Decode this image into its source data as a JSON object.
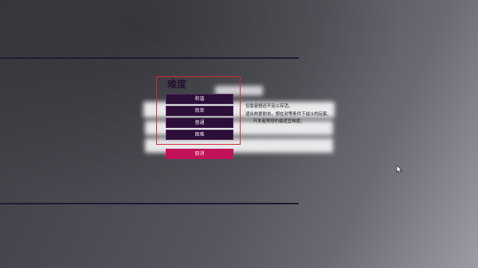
{
  "dialog": {
    "title": "难度",
    "options": [
      {
        "label": "和谐"
      },
      {
        "label": "简单"
      },
      {
        "label": "普通"
      },
      {
        "label": "困难"
      }
    ],
    "cancel_label": "取消",
    "description": {
      "line1": "仅靠容貌还不足以存活。",
      "line2": "适合热爱射击，想在对等条件下战斗的玩家。",
      "line3": "- 开发者预想的最适宜难度。"
    }
  },
  "colors": {
    "option_bg": "#2b0f38",
    "cancel_bg": "#c2135a",
    "outline": "#d42b35"
  }
}
